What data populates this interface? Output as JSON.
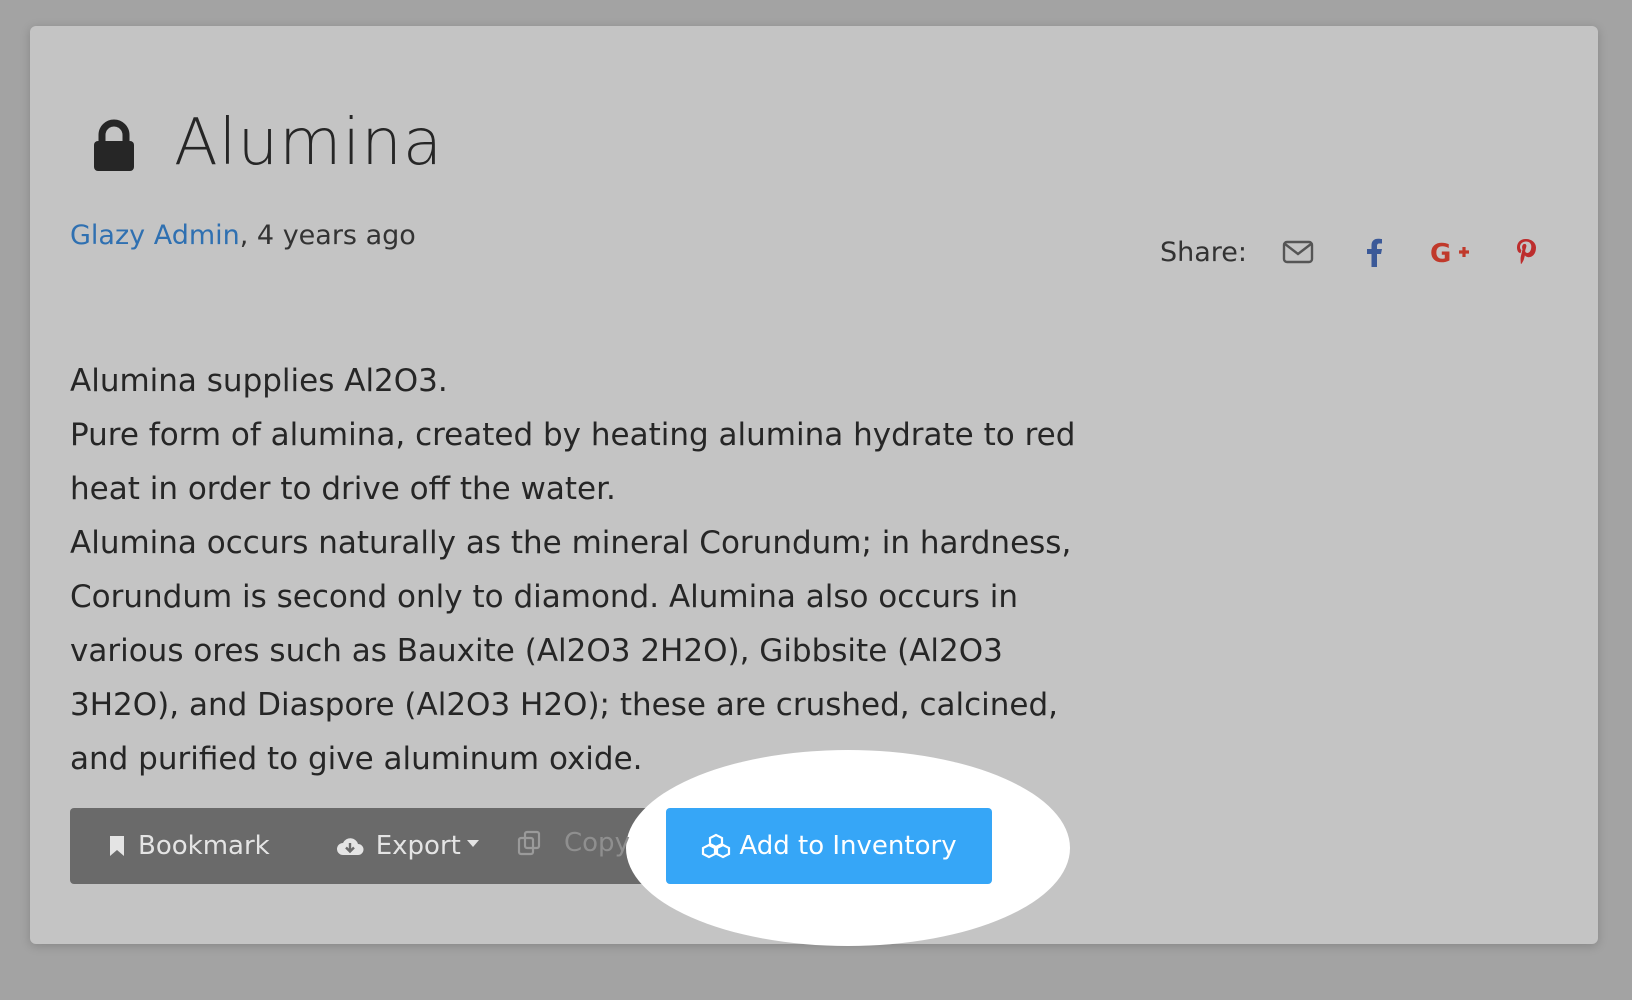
{
  "material": {
    "title": "Alumina",
    "author": "Glazy Admin",
    "time_ago": ", 4 years ago",
    "description": "Alumina supplies Al2O3.\n Pure form of alumina, created by heating alumina hydrate to red\n heat in order to drive off the water.\n Alumina occurs naturally as the mineral Corundum; in hardness,\n Corundum is second only to diamond. Alumina also occurs in\n various ores such as Bauxite (Al2O3 2H2O), Gibbsite (Al2O3\n 3H2O), and Diaspore (Al2O3 H2O); these are crushed, calcined,\n and purified to give aluminum oxide."
  },
  "share": {
    "label": "Share:",
    "icons": [
      "envelope-icon",
      "facebook-icon",
      "google-plus-icon",
      "pinterest-icon"
    ]
  },
  "actions": {
    "bookmark_label": "Bookmark",
    "export_label": "Export",
    "copy_label": "Copy",
    "add_inventory_label": "Add to Inventory"
  },
  "colors": {
    "page_bg": "#a3a3a3",
    "card_bg": "#c4c4c4",
    "link": "#2f70b1",
    "button_group": "#6a6a6a",
    "primary": "#36a6f7",
    "facebook": "#3b5998",
    "google_plus": "#c0392b",
    "pinterest": "#bd2d2d"
  }
}
